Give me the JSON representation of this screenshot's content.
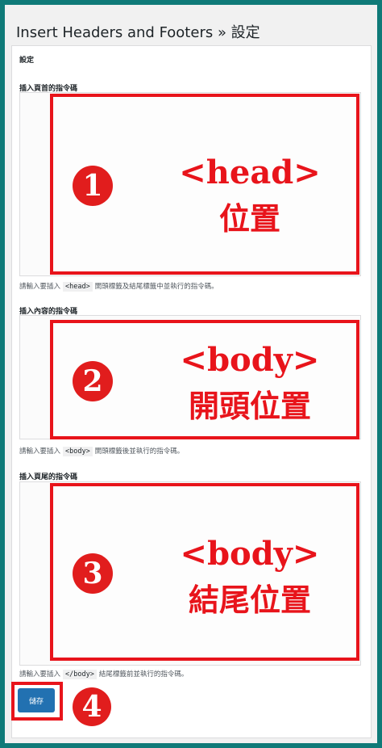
{
  "page": {
    "title": "Insert Headers and Footers » 設定",
    "panel_heading": "設定"
  },
  "sections": [
    {
      "label": "插入頁首的指令碼",
      "help_before": "請輸入要插入",
      "help_code": "<head>",
      "help_after": "開頭標籤及結尾標籤中並執行的指令碼。",
      "annotation_number": "1",
      "annotation_title": "<head>",
      "annotation_subtitle": "位置"
    },
    {
      "label": "插入內容的指令碼",
      "help_before": "請輸入要插入",
      "help_code": "<body>",
      "help_after": "開頭標籤後並執行的指令碼。",
      "annotation_number": "2",
      "annotation_title": "<body>",
      "annotation_subtitle": "開頭位置"
    },
    {
      "label": "插入頁尾的指令碼",
      "help_before": "請輸入要插入",
      "help_code": "</body>",
      "help_after": "結尾標籤前並執行的指令碼。",
      "annotation_number": "3",
      "annotation_title": "<body>",
      "annotation_subtitle": "結尾位置"
    }
  ],
  "save": {
    "label": "儲存",
    "annotation_number": "4"
  },
  "colors": {
    "accent_red": "#e8141b",
    "button_blue": "#2271b1",
    "border_teal": "#0f7a78"
  }
}
